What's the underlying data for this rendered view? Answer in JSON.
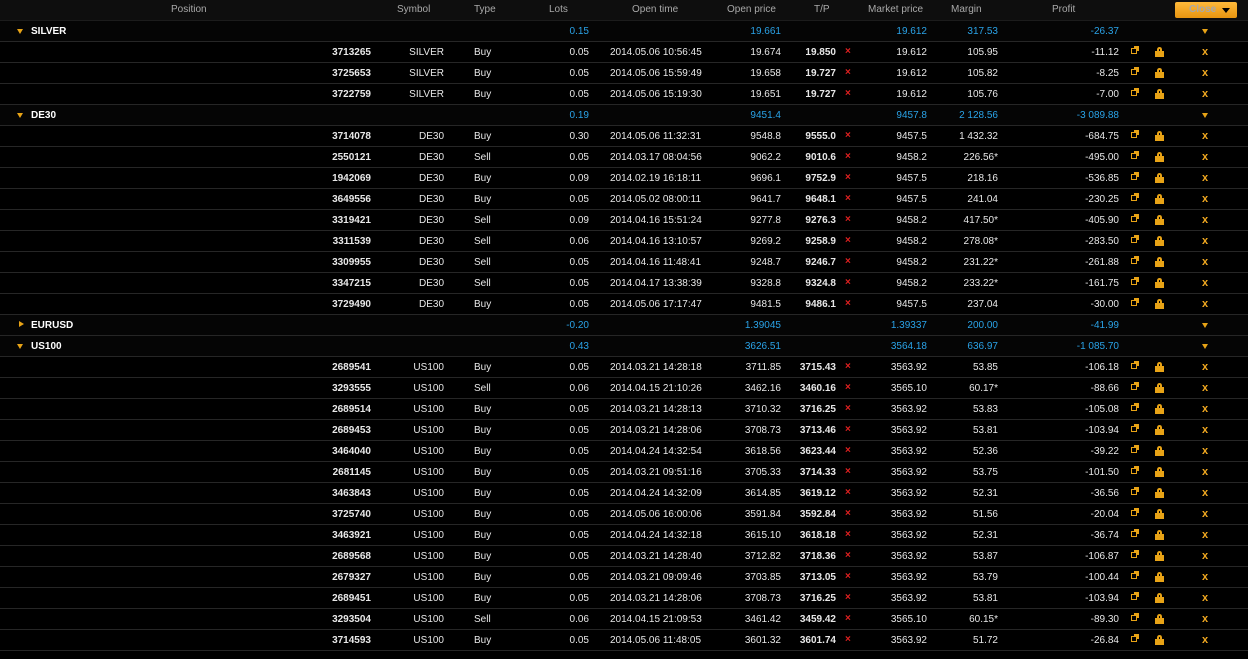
{
  "header": {
    "position": "Position",
    "symbol": "Symbol",
    "type": "Type",
    "lots": "Lots",
    "open_time": "Open time",
    "open_price": "Open price",
    "tp": "T/P",
    "market_price": "Market price",
    "margin": "Margin",
    "profit": "Profit",
    "close_button": "Close"
  },
  "groups": [
    {
      "name": "SILVER",
      "expanded": true,
      "lots": "0.15",
      "open_price": "19.661",
      "market_price": "19.612",
      "margin": "317.53",
      "profit": "-26.37",
      "positions": [
        {
          "id": "3713265",
          "symbol": "SILVER",
          "type": "Buy",
          "lots": "0.05",
          "open_time": "2014.05.06 10:56:45",
          "open_price": "19.674",
          "tp": "19.850",
          "market_price": "19.612",
          "margin": "105.95",
          "profit": "-11.12"
        },
        {
          "id": "3725653",
          "symbol": "SILVER",
          "type": "Buy",
          "lots": "0.05",
          "open_time": "2014.05.06 15:59:49",
          "open_price": "19.658",
          "tp": "19.727",
          "market_price": "19.612",
          "margin": "105.82",
          "profit": "-8.25"
        },
        {
          "id": "3722759",
          "symbol": "SILVER",
          "type": "Buy",
          "lots": "0.05",
          "open_time": "2014.05.06 15:19:30",
          "open_price": "19.651",
          "tp": "19.727",
          "market_price": "19.612",
          "margin": "105.76",
          "profit": "-7.00"
        }
      ]
    },
    {
      "name": "DE30",
      "expanded": true,
      "lots": "0.19",
      "open_price": "9451.4",
      "market_price": "9457.8",
      "margin": "2 128.56",
      "profit": "-3 089.88",
      "positions": [
        {
          "id": "3714078",
          "symbol": "DE30",
          "type": "Buy",
          "lots": "0.30",
          "open_time": "2014.05.06 11:32:31",
          "open_price": "9548.8",
          "tp": "9555.0",
          "market_price": "9457.5",
          "margin": "1 432.32",
          "profit": "-684.75"
        },
        {
          "id": "2550121",
          "symbol": "DE30",
          "type": "Sell",
          "lots": "0.05",
          "open_time": "2014.03.17 08:04:56",
          "open_price": "9062.2",
          "tp": "9010.6",
          "market_price": "9458.2",
          "margin": "226.56*",
          "profit": "-495.00"
        },
        {
          "id": "1942069",
          "symbol": "DE30",
          "type": "Buy",
          "lots": "0.09",
          "open_time": "2014.02.19 16:18:11",
          "open_price": "9696.1",
          "tp": "9752.9",
          "market_price": "9457.5",
          "margin": "218.16",
          "profit": "-536.85"
        },
        {
          "id": "3649556",
          "symbol": "DE30",
          "type": "Buy",
          "lots": "0.05",
          "open_time": "2014.05.02 08:00:11",
          "open_price": "9641.7",
          "tp": "9648.1",
          "market_price": "9457.5",
          "margin": "241.04",
          "profit": "-230.25"
        },
        {
          "id": "3319421",
          "symbol": "DE30",
          "type": "Sell",
          "lots": "0.09",
          "open_time": "2014.04.16 15:51:24",
          "open_price": "9277.8",
          "tp": "9276.3",
          "market_price": "9458.2",
          "margin": "417.50*",
          "profit": "-405.90"
        },
        {
          "id": "3311539",
          "symbol": "DE30",
          "type": "Sell",
          "lots": "0.06",
          "open_time": "2014.04.16 13:10:57",
          "open_price": "9269.2",
          "tp": "9258.9",
          "market_price": "9458.2",
          "margin": "278.08*",
          "profit": "-283.50"
        },
        {
          "id": "3309955",
          "symbol": "DE30",
          "type": "Sell",
          "lots": "0.05",
          "open_time": "2014.04.16 11:48:41",
          "open_price": "9248.7",
          "tp": "9246.7",
          "market_price": "9458.2",
          "margin": "231.22*",
          "profit": "-261.88"
        },
        {
          "id": "3347215",
          "symbol": "DE30",
          "type": "Sell",
          "lots": "0.05",
          "open_time": "2014.04.17 13:38:39",
          "open_price": "9328.8",
          "tp": "9324.8",
          "market_price": "9458.2",
          "margin": "233.22*",
          "profit": "-161.75"
        },
        {
          "id": "3729490",
          "symbol": "DE30",
          "type": "Buy",
          "lots": "0.05",
          "open_time": "2014.05.06 17:17:47",
          "open_price": "9481.5",
          "tp": "9486.1",
          "market_price": "9457.5",
          "margin": "237.04",
          "profit": "-30.00"
        }
      ]
    },
    {
      "name": "EURUSD",
      "expanded": false,
      "lots": "-0.20",
      "open_price": "1.39045",
      "market_price": "1.39337",
      "margin": "200.00",
      "profit": "-41.99",
      "positions": []
    },
    {
      "name": "US100",
      "expanded": true,
      "lots": "0.43",
      "open_price": "3626.51",
      "market_price": "3564.18",
      "margin": "636.97",
      "profit": "-1 085.70",
      "positions": [
        {
          "id": "2689541",
          "symbol": "US100",
          "type": "Buy",
          "lots": "0.05",
          "open_time": "2014.03.21 14:28:18",
          "open_price": "3711.85",
          "tp": "3715.43",
          "market_price": "3563.92",
          "margin": "53.85",
          "profit": "-106.18"
        },
        {
          "id": "3293555",
          "symbol": "US100",
          "type": "Sell",
          "lots": "0.06",
          "open_time": "2014.04.15 21:10:26",
          "open_price": "3462.16",
          "tp": "3460.16",
          "market_price": "3565.10",
          "margin": "60.17*",
          "profit": "-88.66"
        },
        {
          "id": "2689514",
          "symbol": "US100",
          "type": "Buy",
          "lots": "0.05",
          "open_time": "2014.03.21 14:28:13",
          "open_price": "3710.32",
          "tp": "3716.25",
          "market_price": "3563.92",
          "margin": "53.83",
          "profit": "-105.08"
        },
        {
          "id": "2689453",
          "symbol": "US100",
          "type": "Buy",
          "lots": "0.05",
          "open_time": "2014.03.21 14:28:06",
          "open_price": "3708.73",
          "tp": "3713.46",
          "market_price": "3563.92",
          "margin": "53.81",
          "profit": "-103.94"
        },
        {
          "id": "3464040",
          "symbol": "US100",
          "type": "Buy",
          "lots": "0.05",
          "open_time": "2014.04.24 14:32:54",
          "open_price": "3618.56",
          "tp": "3623.44",
          "market_price": "3563.92",
          "margin": "52.36",
          "profit": "-39.22"
        },
        {
          "id": "2681145",
          "symbol": "US100",
          "type": "Buy",
          "lots": "0.05",
          "open_time": "2014.03.21 09:51:16",
          "open_price": "3705.33",
          "tp": "3714.33",
          "market_price": "3563.92",
          "margin": "53.75",
          "profit": "-101.50"
        },
        {
          "id": "3463843",
          "symbol": "US100",
          "type": "Buy",
          "lots": "0.05",
          "open_time": "2014.04.24 14:32:09",
          "open_price": "3614.85",
          "tp": "3619.12",
          "market_price": "3563.92",
          "margin": "52.31",
          "profit": "-36.56"
        },
        {
          "id": "3725740",
          "symbol": "US100",
          "type": "Buy",
          "lots": "0.05",
          "open_time": "2014.05.06 16:00:06",
          "open_price": "3591.84",
          "tp": "3592.84",
          "market_price": "3563.92",
          "margin": "51.56",
          "profit": "-20.04"
        },
        {
          "id": "3463921",
          "symbol": "US100",
          "type": "Buy",
          "lots": "0.05",
          "open_time": "2014.04.24 14:32:18",
          "open_price": "3615.10",
          "tp": "3618.18",
          "market_price": "3563.92",
          "margin": "52.31",
          "profit": "-36.74"
        },
        {
          "id": "2689568",
          "symbol": "US100",
          "type": "Buy",
          "lots": "0.05",
          "open_time": "2014.03.21 14:28:40",
          "open_price": "3712.82",
          "tp": "3718.36",
          "market_price": "3563.92",
          "margin": "53.87",
          "profit": "-106.87"
        },
        {
          "id": "2679327",
          "symbol": "US100",
          "type": "Buy",
          "lots": "0.05",
          "open_time": "2014.03.21 09:09:46",
          "open_price": "3703.85",
          "tp": "3713.05",
          "market_price": "3563.92",
          "margin": "53.79",
          "profit": "-100.44"
        },
        {
          "id": "2689451",
          "symbol": "US100",
          "type": "Buy",
          "lots": "0.05",
          "open_time": "2014.03.21 14:28:06",
          "open_price": "3708.73",
          "tp": "3716.25",
          "market_price": "3563.92",
          "margin": "53.81",
          "profit": "-103.94"
        },
        {
          "id": "3293504",
          "symbol": "US100",
          "type": "Sell",
          "lots": "0.06",
          "open_time": "2014.04.15 21:09:53",
          "open_price": "3461.42",
          "tp": "3459.42",
          "market_price": "3565.10",
          "margin": "60.15*",
          "profit": "-89.30"
        },
        {
          "id": "3714593",
          "symbol": "US100",
          "type": "Buy",
          "lots": "0.05",
          "open_time": "2014.05.06 11:48:05",
          "open_price": "3601.32",
          "tp": "3601.74",
          "market_price": "3563.92",
          "margin": "51.72",
          "profit": "-26.84"
        }
      ]
    }
  ],
  "colors": {
    "accent": "#e8a316",
    "summary_blue": "#2aa3e8",
    "close_x_red": "#e02020"
  },
  "icons": {
    "expanded": "triangle-down-icon",
    "collapsed": "triangle-right-icon",
    "remove_tp": "x-icon",
    "modify": "expand-icon",
    "lock": "lock-icon",
    "close_position": "close-x-icon"
  }
}
